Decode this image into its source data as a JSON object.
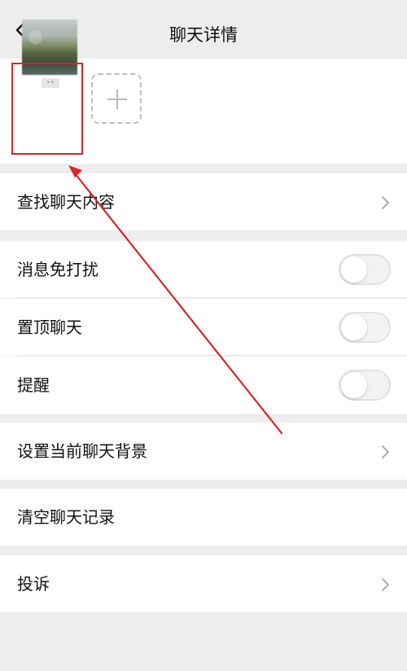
{
  "header": {
    "title": "聊天详情",
    "back_icon": "chevron-left-icon"
  },
  "members": {
    "selected_member_name": "••",
    "add_icon": "plus-icon"
  },
  "sections": {
    "search": {
      "label": "查找聊天内容",
      "chevron_icon": "chevron-right-icon"
    },
    "settings": [
      {
        "label": "消息免打扰",
        "enabled": false,
        "toggle_icon": "toggle-switch-icon"
      },
      {
        "label": "置顶聊天",
        "enabled": false,
        "toggle_icon": "toggle-switch-icon"
      },
      {
        "label": "提醒",
        "enabled": false,
        "toggle_icon": "toggle-switch-icon"
      }
    ],
    "background": {
      "label": "设置当前聊天背景",
      "chevron_icon": "chevron-right-icon"
    },
    "clear": {
      "label": "清空聊天记录"
    },
    "complaint": {
      "label": "投诉",
      "chevron_icon": "chevron-right-icon"
    }
  },
  "colors": {
    "background": "#ededed",
    "card": "#ffffff",
    "text": "#111111",
    "divider": "#e7e7e7",
    "toggle_off": "#f2f2f2",
    "annotation_red": "#d8262a"
  }
}
